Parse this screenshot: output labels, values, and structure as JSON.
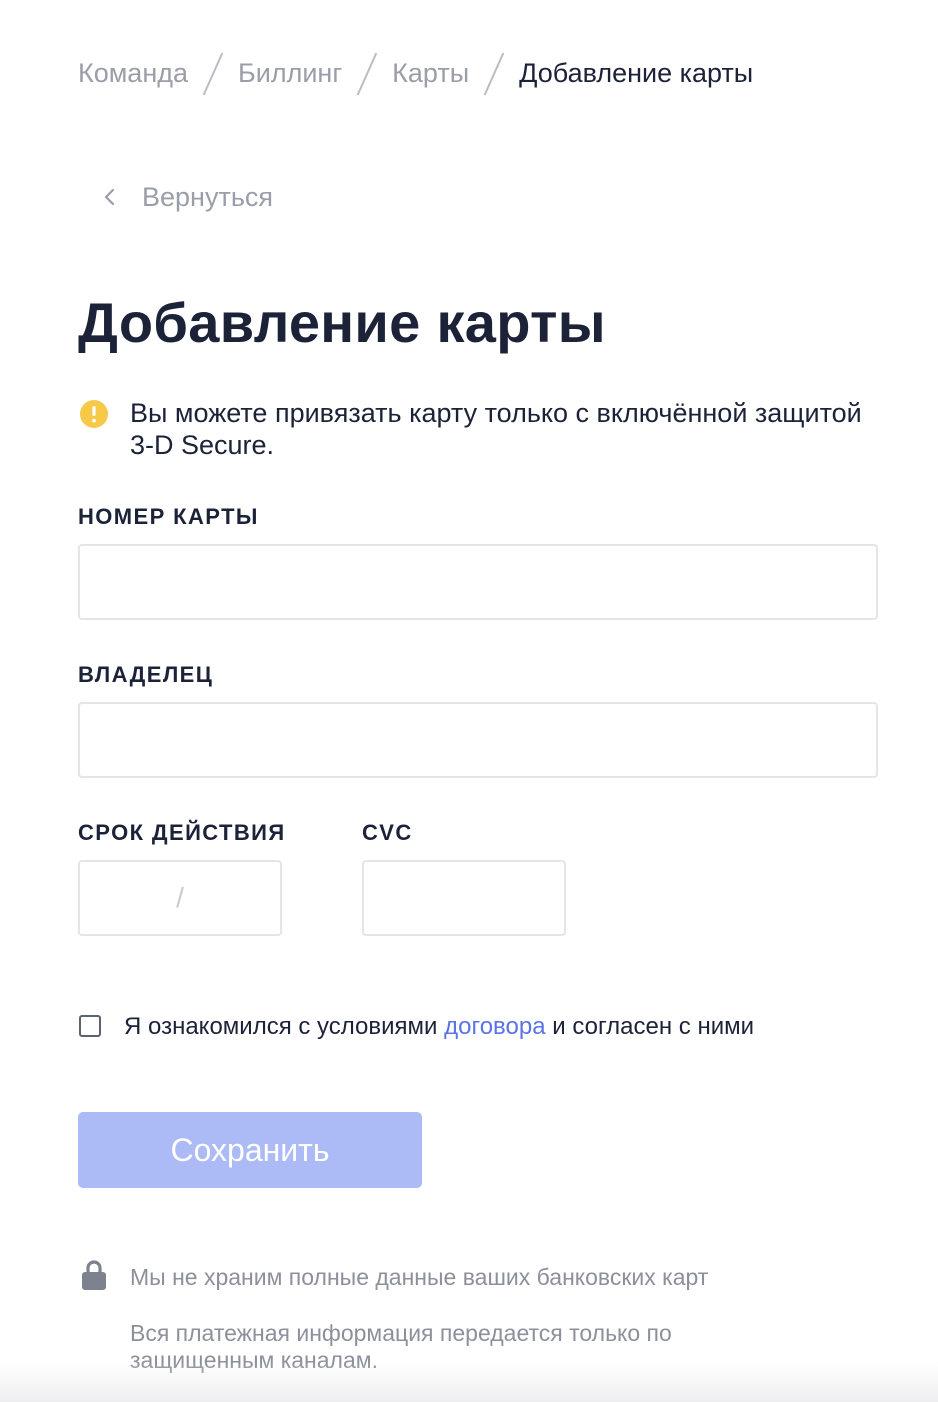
{
  "breadcrumb": {
    "items": [
      "Команда",
      "Биллинг",
      "Карты"
    ],
    "current": "Добавление карты"
  },
  "back": {
    "label": "Вернуться",
    "icon": "chevron-left-icon"
  },
  "page": {
    "title": "Добавление карты"
  },
  "notice": {
    "icon": "warning-icon",
    "icon_color": "#f7c948",
    "text": "Вы можете привязать карту только с включённой защитой 3-D Secure."
  },
  "form": {
    "card_number": {
      "label": "НОМЕР КАРТЫ",
      "value": ""
    },
    "owner": {
      "label": "ВЛАДЕЛЕЦ",
      "value": ""
    },
    "expiry": {
      "label": "СРОК ДЕЙСТВИЯ",
      "separator": "/"
    },
    "cvc": {
      "label": "CVC",
      "value": ""
    },
    "agreement": {
      "checked": false,
      "text_before": "Я ознакомился с условиями ",
      "link_text": "договора",
      "text_after": " и согласен с ними"
    },
    "save_label": "Сохранить"
  },
  "footer": {
    "icon": "lock-icon",
    "line1": "Мы не храним полные данные ваших банковских карт",
    "line2": "Вся платежная информация передается только по защищенным каналам."
  },
  "colors": {
    "text_primary": "#1c2238",
    "text_muted": "#9a9ea8",
    "link": "#5b73e8",
    "button_disabled": "#acbaf6",
    "warning": "#f7c948",
    "input_border": "#e4e5e9"
  }
}
